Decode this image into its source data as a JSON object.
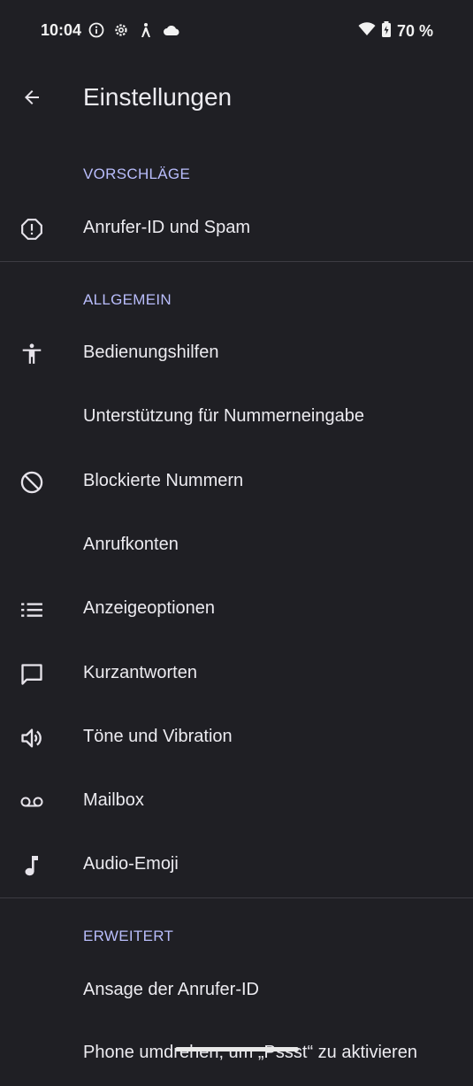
{
  "status_bar": {
    "time": "10:04",
    "battery": "70 %",
    "icons": [
      "info-icon",
      "settings-icon",
      "accessibility-icon",
      "cloud-icon",
      "wifi-icon",
      "battery-icon"
    ]
  },
  "app_bar": {
    "title": "Einstellungen",
    "back_icon": "arrow-back-icon"
  },
  "sections": {
    "suggestions": {
      "header": "VORSCHLÄGE",
      "items": [
        {
          "label": "Anrufer-ID und Spam",
          "icon": "alert-octagon-icon"
        }
      ]
    },
    "general": {
      "header": "ALLGEMEIN",
      "items": [
        {
          "label": "Bedienungshilfen",
          "icon": "accessibility-icon"
        },
        {
          "label": "Unterstützung für Nummerneingabe",
          "icon": ""
        },
        {
          "label": "Blockierte Nummern",
          "icon": "block-icon"
        },
        {
          "label": "Anrufkonten",
          "icon": ""
        },
        {
          "label": "Anzeigeoptionen",
          "icon": "list-icon"
        },
        {
          "label": "Kurzantworten",
          "icon": "message-icon"
        },
        {
          "label": "Töne und Vibration",
          "icon": "volume-icon"
        },
        {
          "label": "Mailbox",
          "icon": "voicemail-icon"
        },
        {
          "label": "Audio-Emoji",
          "icon": "music-note-icon"
        }
      ]
    },
    "advanced": {
      "header": "ERWEITERT",
      "items": [
        {
          "label": "Ansage der Anrufer-ID",
          "icon": ""
        },
        {
          "label": "Phone umdrehen, um „Pssst“ zu aktivieren",
          "icon": ""
        }
      ]
    }
  },
  "colors": {
    "background": "#1f1f24",
    "section_header": "#b9bdfc",
    "text": "#ecebf0",
    "divider": "#3c3b42"
  }
}
